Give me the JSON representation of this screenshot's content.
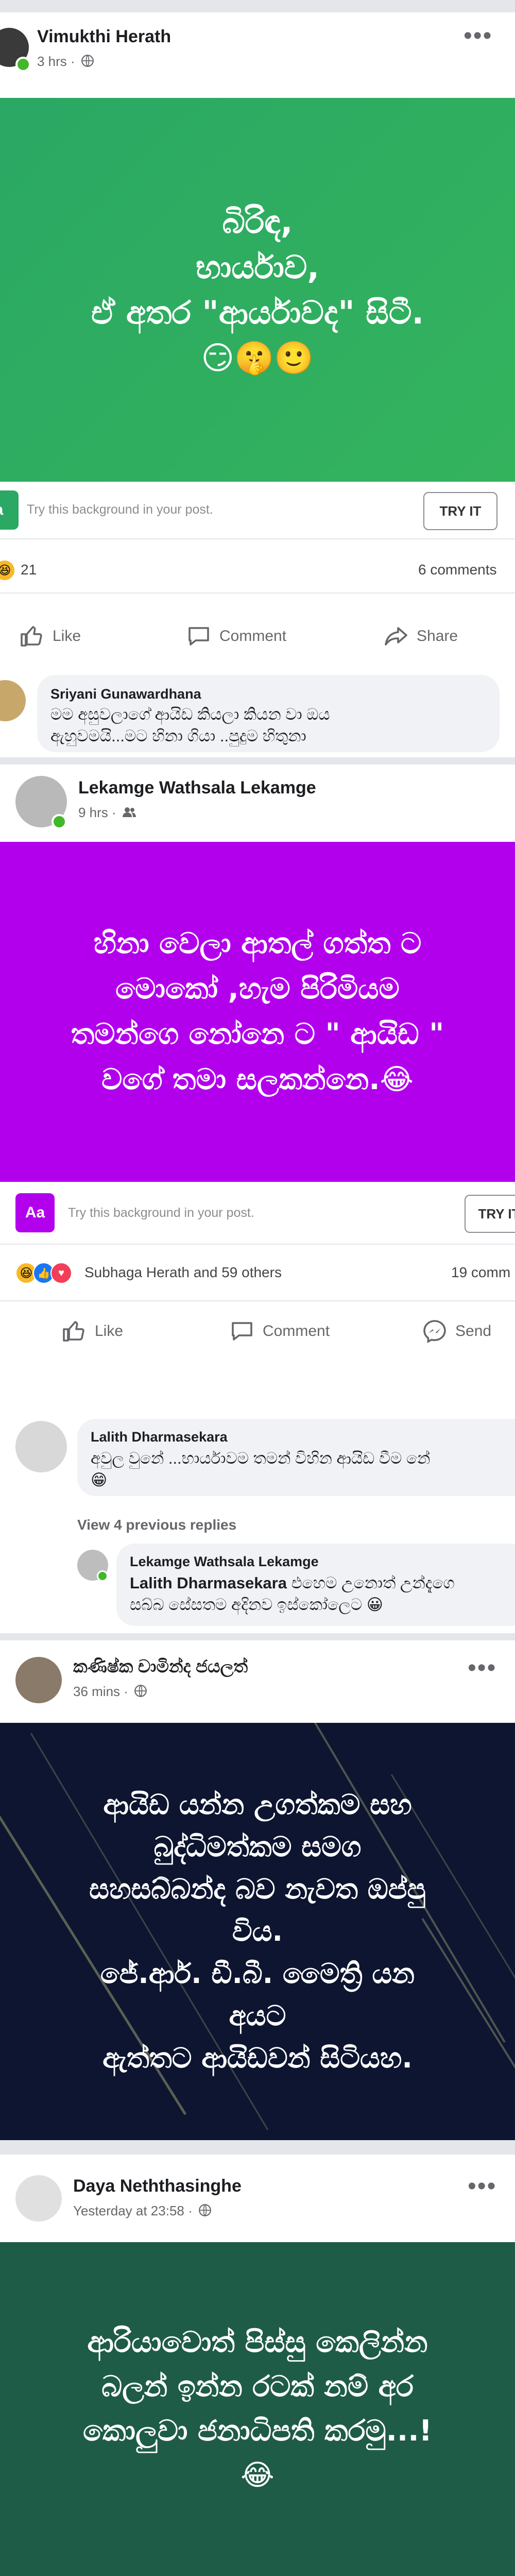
{
  "posts": [
    {
      "author": "Vimukthi Herath",
      "meta": "3 hrs ·",
      "banner_text": "බිරිඳ,\nභාර්යාව,\nඒ අතර \"ආර්යාවද\" සිටී.\n😏🤫🙂",
      "banner_color": "#2fae5f",
      "bg_hint": "Try this background in your post.",
      "try_label": "TRY IT",
      "reaction_count": "21",
      "comments_count": "6 comments",
      "actions": [
        "Like",
        "Comment",
        "Share"
      ],
      "comment": {
        "author": "Sriyani Gunawardhana",
        "text": "මම අසුවලාගේ ආයිඩ කියලා කියන වා ඔය\nඇහුවමයි...මට හිනා ගියා ..පුදුම හිතුනා"
      }
    },
    {
      "author": "Lekamge Wathsala Lekamge",
      "meta": "9 hrs ·",
      "banner_text": "හිනා වෙලා ආතල් ගත්ත ට\nමොකෝ ,හැම පිරිමියම\nතමන්ගෙ නෝනෙ ට \"  ආයිඩ \"\nවගේ තමා සලකන්නෙ.😂",
      "banner_color": "#b200ed",
      "aa_label": "Aa",
      "bg_hint": "Try this background in your post.",
      "try_label": "TRY IT",
      "reaction_text": "Subhaga Herath and 59 others",
      "comments_count": "19 comm",
      "actions": [
        "Like",
        "Comment",
        "Send"
      ],
      "comment": {
        "author": "Lalith Dharmasekara",
        "text": "අවුල වුනේ ...භාර්යාවම තමන් විහින ආයිඩ වීම නේ\n😁"
      },
      "previous_replies": "View 4 previous replies",
      "reply": {
        "author": "Lekamge Wathsala Lekamge",
        "mention": "Lalith Dharmasekara",
        "text": " එහෙම උනොත් උන්දැගෙ\nසබ්බ සේසතම අදිනව ඉස්කෝලෙට 😀"
      }
    },
    {
      "author": "කණිෂ්ක චාමින්ද ජයලත්",
      "meta": "36 mins ·",
      "banner_text": "ආයිඩ යන්න උගත්කම සහ\nබුද්ධිමත්කම සමග\nසහසබ්බන්ද බව නැවත ඔප්පු\nවිය.\nජේ.ආර්. ඩී.බී. මෛත්‍රි යන\nඅයට\nඇත්තට ආයිඩවන් සිටියහ.",
      "banner_color": "#0d1530"
    },
    {
      "author": "Daya Neththasinghe",
      "meta": "Yesterday at 23:58 ·",
      "banner_text": "ආරියාවොත් පිස්සු කෙලින්න\nබලන් ඉන්න රටක් නම් අර\nකොලුවා ජනාධිපති කරමු...!\n😂",
      "banner_color": "#1f5c47"
    }
  ],
  "icons": {
    "globe": "globe-icon",
    "friends": "friends-icon",
    "like": "like-icon",
    "comment": "comment-icon",
    "share": "share-icon",
    "messenger": "messenger-icon",
    "more": "more-options-icon"
  }
}
